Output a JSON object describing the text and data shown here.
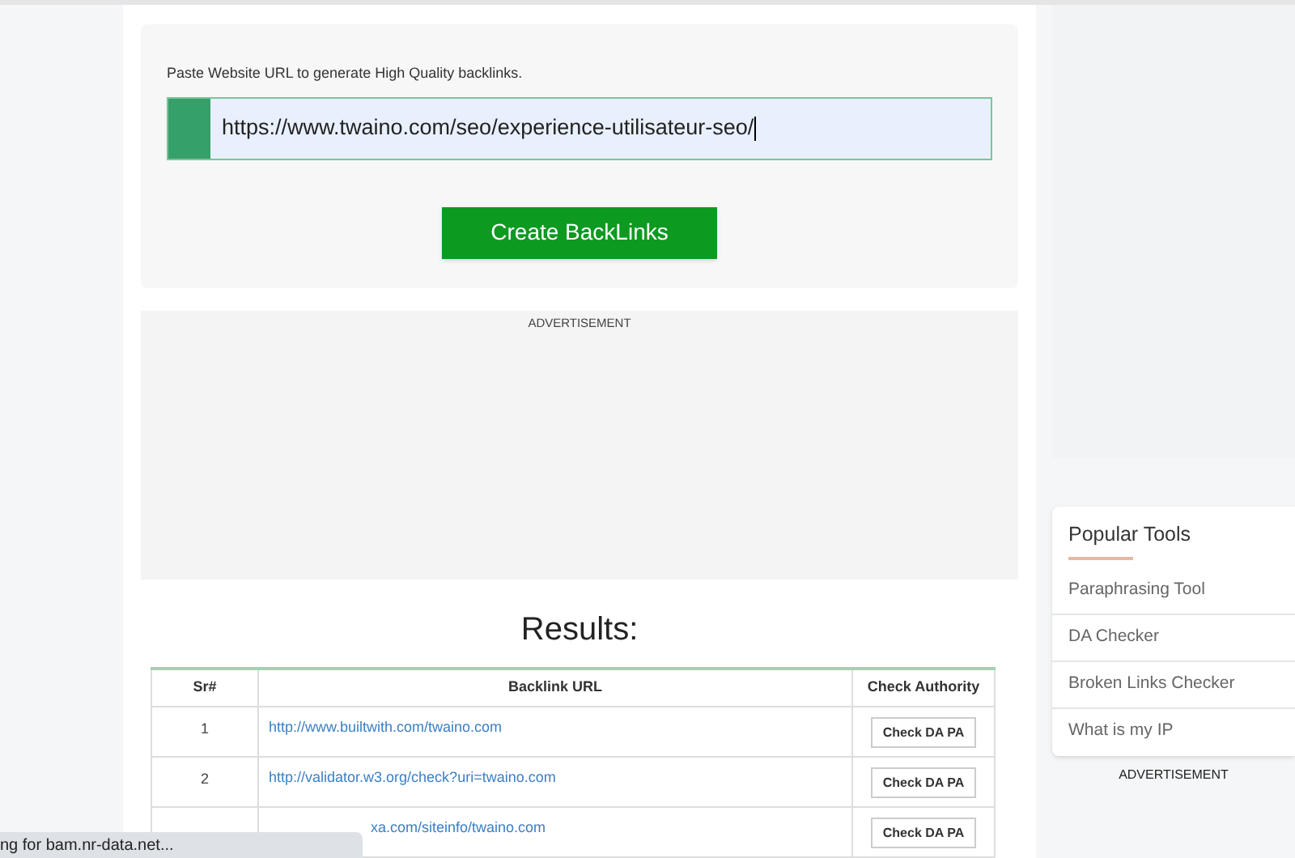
{
  "form": {
    "label": "Paste Website URL to generate High Quality backlinks.",
    "url_value": "https://www.twaino.com/seo/experience-utilisateur-seo/",
    "focused": true,
    "button": "Create BackLinks"
  },
  "ad_label": "ADVERTISEMENT",
  "results": {
    "title": "Results:",
    "columns": [
      "Sr#",
      "Backlink URL",
      "Check Authority"
    ],
    "rows": [
      {
        "sr": "1",
        "url": "http://www.builtwith.com/twaino.com",
        "action": "Check DA PA"
      },
      {
        "sr": "2",
        "url": "http://validator.w3.org/check?uri=twaino.com",
        "action": "Check DA PA"
      },
      {
        "url": "xa.com/siteinfo/twaino.com",
        "action": "Check DA PA"
      }
    ]
  },
  "sidebar": {
    "title": "Popular Tools",
    "items": [
      "Paraphrasing Tool",
      "DA Checker",
      "Broken Links Checker",
      "What is my IP"
    ],
    "ad_label": "ADVERTISEMENT"
  },
  "status_bar": "ng for bam.nr-data.net..."
}
